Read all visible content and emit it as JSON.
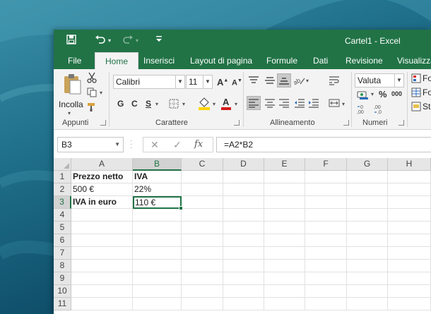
{
  "window": {
    "title": "Cartel1 - Excel"
  },
  "tabs": [
    {
      "label": "File",
      "active": false
    },
    {
      "label": "Home",
      "active": true
    },
    {
      "label": "Inserisci",
      "active": false
    },
    {
      "label": "Layout di pagina",
      "active": false
    },
    {
      "label": "Formule",
      "active": false
    },
    {
      "label": "Dati",
      "active": false
    },
    {
      "label": "Revisione",
      "active": false
    },
    {
      "label": "Visualizza",
      "active": false
    }
  ],
  "ribbon": {
    "clipboard": {
      "paste_label": "Incolla",
      "group_label": "Appunti"
    },
    "font": {
      "font_name": "Calibri",
      "font_size": "11",
      "bold": "G",
      "italic": "C",
      "underline": "S",
      "group_label": "Carattere"
    },
    "alignment": {
      "group_label": "Allineamento"
    },
    "number": {
      "format": "Valuta",
      "group_label": "Numeri"
    },
    "styles_partial": [
      "Fo",
      "Fo",
      "St"
    ],
    "colors": {
      "fill": "#ffd400",
      "font": "#d41c1c"
    }
  },
  "formula_bar": {
    "name_box": "B3",
    "formula": "=A2*B2",
    "fx_label": "fx"
  },
  "sheet": {
    "columns": [
      "A",
      "B",
      "C",
      "D",
      "E",
      "F",
      "G",
      "H"
    ],
    "selected_column": "B",
    "rows": [
      "1",
      "2",
      "3",
      "4",
      "5",
      "6",
      "7",
      "8",
      "9",
      "10",
      "11"
    ],
    "selected_row": "3",
    "active_cell": "B3",
    "cells": {
      "A1": "Prezzo netto",
      "B1": "IVA",
      "A2": "500 €",
      "B2": "22%",
      "A3": "IVA in euro",
      "B3": "110 €"
    }
  },
  "theme": {
    "accent": "#217346"
  }
}
